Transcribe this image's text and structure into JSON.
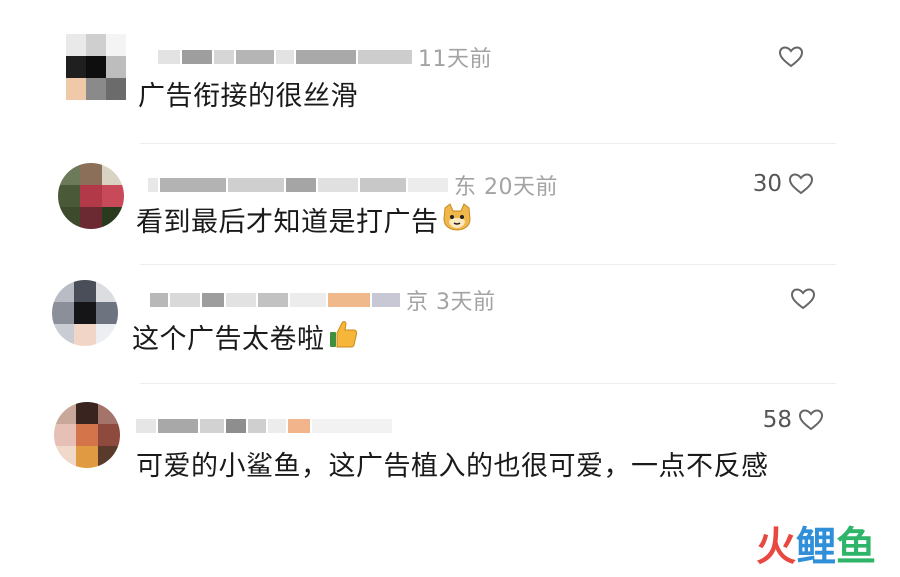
{
  "comments": [
    {
      "meta": "11天前",
      "text": "广告衔接的很丝滑",
      "likes": ""
    },
    {
      "meta": "东 20天前",
      "text": "看到最后才知道是打广告",
      "likes": "30"
    },
    {
      "meta": "京 3天前",
      "text": "这个广告太卷啦",
      "likes": ""
    },
    {
      "meta": "",
      "text": "可爱的小鲨鱼，这广告植入的也很可爱，一点不反感",
      "likes": "58"
    }
  ],
  "watermark": {
    "char1": "火",
    "char2": "鲤",
    "char3": "鱼"
  },
  "icons": {
    "like": "heart-outline-icon",
    "emoji_cat": "cat-face-emoji",
    "emoji_thumb": "thumbs-up-emoji"
  },
  "colors": {
    "text": "#1a1a1a",
    "meta": "#a3a3a3",
    "watermark_red": "#e8483f",
    "watermark_blue": "#2f8fd8",
    "watermark_green": "#2fb56a"
  }
}
